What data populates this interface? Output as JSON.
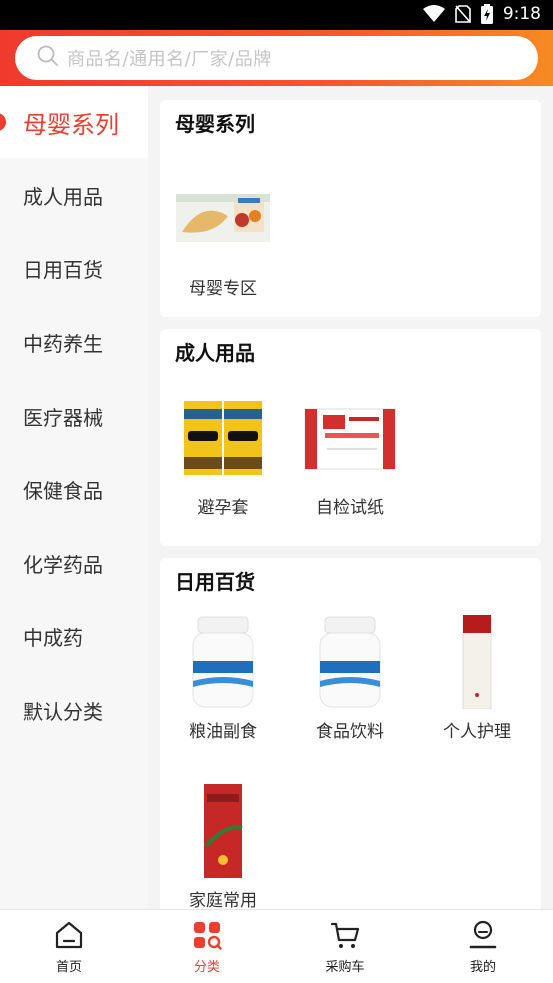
{
  "status_bar": {
    "time": "9:18"
  },
  "search": {
    "placeholder": "商品名/通用名/厂家/品牌"
  },
  "sidebar": {
    "items": [
      {
        "label": "母婴系列",
        "active": true
      },
      {
        "label": "成人用品"
      },
      {
        "label": "日用百货"
      },
      {
        "label": "中药养生"
      },
      {
        "label": "医疗器械"
      },
      {
        "label": "保健食品"
      },
      {
        "label": "化学药品"
      },
      {
        "label": "中成药"
      },
      {
        "label": "默认分类"
      }
    ]
  },
  "sections": [
    {
      "title": "母婴系列",
      "products": [
        {
          "label": "母婴专区"
        }
      ]
    },
    {
      "title": "成人用品",
      "products": [
        {
          "label": "避孕套"
        },
        {
          "label": "自检试纸"
        }
      ]
    },
    {
      "title": "日用百货",
      "products": [
        {
          "label": "粮油副食"
        },
        {
          "label": "食品饮料"
        },
        {
          "label": "个人护理"
        },
        {
          "label": "家庭常用"
        }
      ]
    }
  ],
  "tabbar": {
    "tabs": [
      {
        "label": "首页"
      },
      {
        "label": "分类",
        "active": true
      },
      {
        "label": "采购车"
      },
      {
        "label": "我的"
      }
    ]
  },
  "colors": {
    "accent": "#ee3e2f",
    "header_gradient_start": "#f03a2e",
    "header_gradient_end": "#f78a22"
  }
}
